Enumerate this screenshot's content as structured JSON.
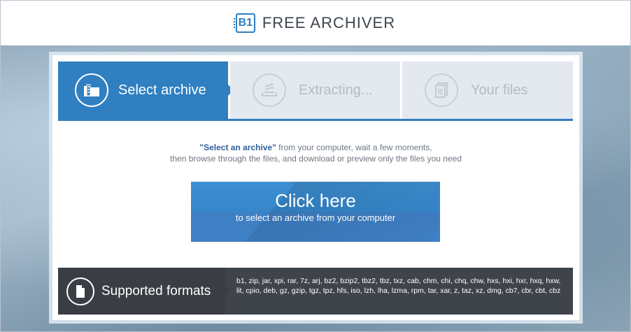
{
  "header": {
    "logo_badge": "B1",
    "logo_text": "FREE ARCHIVER"
  },
  "steps": [
    {
      "label": "Select archive",
      "icon": "archive-icon",
      "active": true
    },
    {
      "label": "Extracting...",
      "icon": "extract-icon",
      "active": false
    },
    {
      "label": "Your files",
      "icon": "files-icon",
      "active": false
    }
  ],
  "description": {
    "highlight": "\"Select an archive\"",
    "line1_rest": " from your computer, wait a few moments,",
    "line2": "then browse through the files, and download or preview only the files you need"
  },
  "cta": {
    "title": "Click here",
    "subtitle": "to select an archive from your computer"
  },
  "formats": {
    "title": "Supported formats",
    "icon": "document-icon",
    "list": "b1, zip, jar, xpi, rar, 7z, arj, bz2, bzip2, tbz2, tbz, txz, cab, chm, chi, chq, chw, hxs, hxi, hxr, hxq, hxw, lit, cpio, deb, gz, gzip, tgz, tpz, hfs, iso, lzh, lha, lzma, rpm, tar, xar, z, taz, xz, dmg, cb7, cbr, cbt, cbz"
  },
  "colors": {
    "accent": "#2f7fc1",
    "inactive_step": "#e4e9ef",
    "formats_bar": "#3f444b"
  }
}
